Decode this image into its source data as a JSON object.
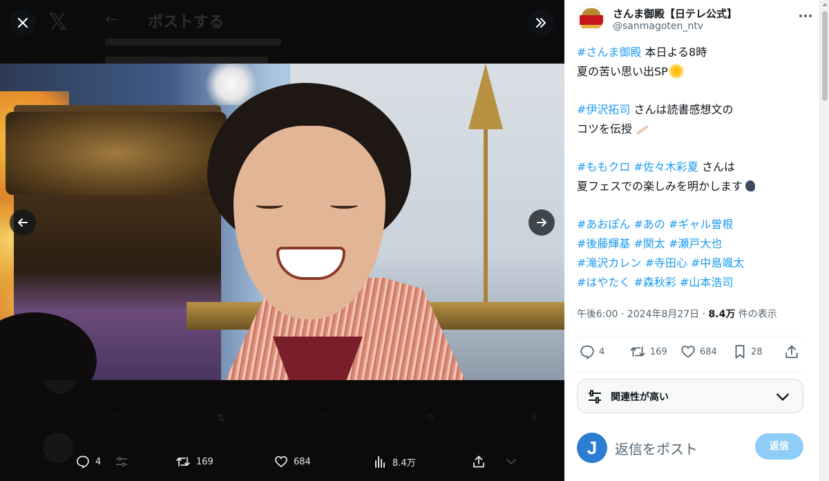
{
  "viewer": {
    "background_page": {
      "title": "ポストする"
    },
    "actions": {
      "replies": "4",
      "reposts": "169",
      "likes": "684",
      "views": "8.4万"
    }
  },
  "tweet": {
    "author": {
      "name": "さんま御殿【日テレ公式】",
      "handle": "@sanmagoten_ntv"
    },
    "lines": [
      {
        "tag": "#さんま御殿",
        "text": " 本日よる8時"
      },
      {
        "text": "夏の苦い思い出SP",
        "emoji": "sun"
      },
      {
        "gap": true
      },
      {
        "tag": "#伊沢拓司",
        "text": " さんは読書感想文の"
      },
      {
        "text": "コツを伝授",
        "emoji": "pen"
      },
      {
        "gap": true
      },
      {
        "tag": "#ももクロ #佐々木彩夏",
        "text": " さんは"
      },
      {
        "text": "夏フェスでの楽しみを明かします",
        "emoji": "speaking-head"
      },
      {
        "gap": true
      },
      {
        "tag": "#あおぽん #あの #ギャル曽根"
      },
      {
        "tag": "#後藤輝基 #関太 #瀬戸大也"
      },
      {
        "tag": "#滝沢カレン #寺田心 #中島颯太"
      },
      {
        "tag": "#はやたく #森秋彩 #山本浩司"
      }
    ],
    "meta": {
      "time": "午後6:00",
      "date": "2024年8月27日",
      "views_count": "8.4万",
      "views_label": "件の表示"
    },
    "stats": {
      "replies": "4",
      "reposts": "169",
      "likes": "684",
      "bookmarks": "28"
    }
  },
  "relevance": {
    "label": "関連性が高い"
  },
  "reply": {
    "avatar_letter": "J",
    "placeholder": "返信をポスト",
    "button": "返信"
  },
  "colors": {
    "accent": "#1d9bf0",
    "reply_button": "#8ecdf7",
    "text": "#0f1419",
    "muted": "#536471"
  }
}
